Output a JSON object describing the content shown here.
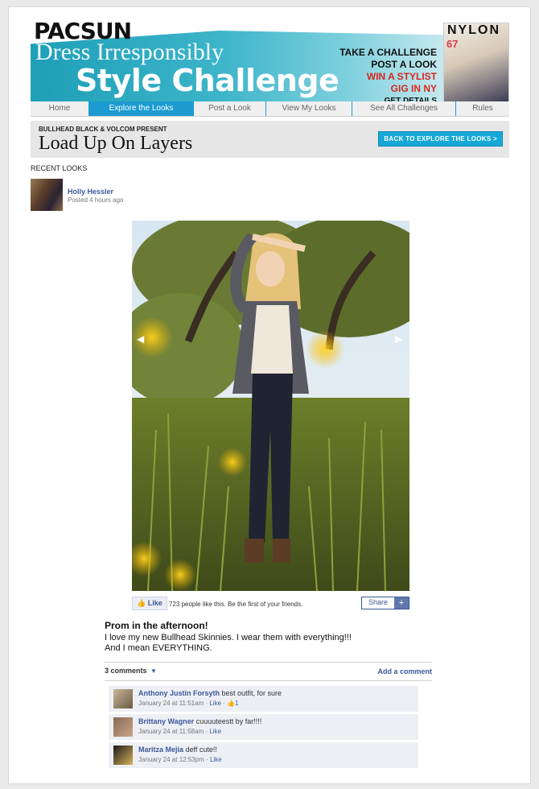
{
  "brand": "PACSUN",
  "banner": {
    "tagline": "Dress Irresponsibly",
    "title": "Style Challenge",
    "promo_line1": "TAKE A CHALLENGE",
    "promo_line2": "POST A LOOK",
    "promo_line3": "WIN A STYLIST",
    "promo_line4": "GIG IN NY",
    "promo_details": "GET DETAILS",
    "magazine_title": "NYLON",
    "magazine_number": "67"
  },
  "nav": {
    "tabs": [
      "Home",
      "Explore the Looks",
      "Post a Look",
      "View My Looks",
      "See All Challenges",
      "Rules"
    ],
    "active_index": 1
  },
  "challenge": {
    "presenter": "BULLHEAD BLACK & VOLCOM PRESENT",
    "title": "Load Up On Layers",
    "back_button": "BACK TO EXPLORE THE LOOKS >"
  },
  "recent_looks_label": "RECENT LOOKS",
  "poster": {
    "name": "Holly Hessler",
    "posted": "Posted 4 hours ago"
  },
  "photo_nav": {
    "prev": "◀",
    "next": "▶"
  },
  "likes": {
    "like_label": "Like",
    "summary": "723 people like this. Be the first of your friends.",
    "share_label": "Share",
    "share_plus": "+"
  },
  "post": {
    "title": "Prom in the afternoon!",
    "body": "I love my new Bullhead Skinnies. I wear them with everything!!!\nAnd I mean EVERYTHING."
  },
  "comments_bar": {
    "count": "3 comments",
    "add": "Add a comment"
  },
  "comments": [
    {
      "name": "Anthony Justin Forsyth",
      "text": "best outfit, for sure",
      "time": "January 24 at 11:51am",
      "sep": " · ",
      "like": "Like",
      "sep2": " · ",
      "likes": "1"
    },
    {
      "name": "Brittany Wagner",
      "text": "cuuuuteestt by far!!!!",
      "time": "January 24 at 11:58am",
      "sep": " · ",
      "like": "Like"
    },
    {
      "name": "Maritza Mejia",
      "text": "deff cute!!",
      "time": "January 24 at 12:53pm",
      "sep": " · ",
      "like": "Like"
    }
  ],
  "colors": {
    "accent_blue": "#1c9bd0",
    "facebook_blue": "#3b5998",
    "promo_red": "#d9281e"
  }
}
